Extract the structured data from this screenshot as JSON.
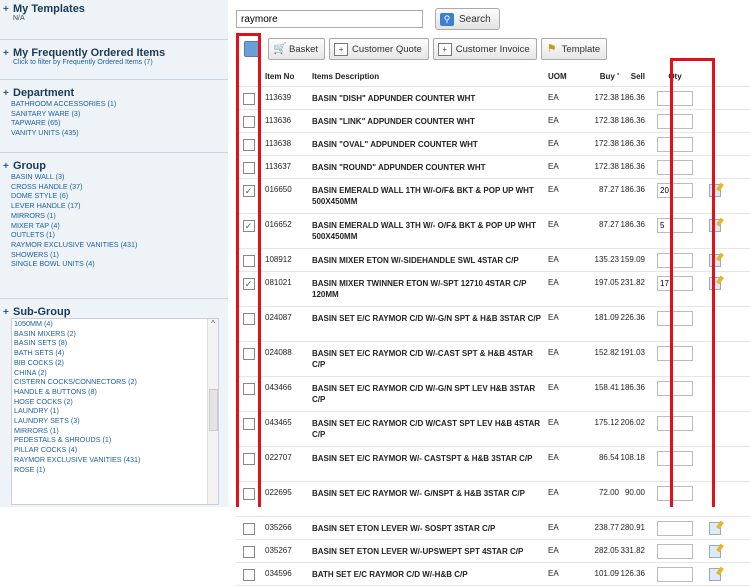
{
  "sidebar": {
    "my_templates": {
      "title": "My Templates",
      "sub": "N/A"
    },
    "frequent": {
      "title": "My Frequently Ordered Items",
      "sub": "Click to filter by Frequently Ordered Items (7)"
    },
    "department": {
      "title": "Department",
      "items": [
        "BATHROOM ACCESSORIES (1)",
        "SANITARY WARE (3)",
        "TAPWARE (65)",
        "VANITY UNITS (435)"
      ]
    },
    "group": {
      "title": "Group",
      "items": [
        "BASIN WALL (3)",
        "CROSS HANDLE (37)",
        "DOME STYLE (6)",
        "LEVER HANDLE (17)",
        "MIRRORS (1)",
        "MIXER TAP (4)",
        "OUTLETS (1)",
        "RAYMOR EXCLUSIVE VANITIES (431)",
        "SHOWERS (1)",
        "SINGLE BOWL UNITS (4)"
      ]
    },
    "subgroup": {
      "title": "Sub-Group",
      "items": [
        "1050MM (4)",
        "BASIN MIXERS (2)",
        "BASIN SETS (8)",
        "BATH SETS (4)",
        "BIB COCKS (2)",
        "CHINA (2)",
        "CISTERN COCKS/CONNECTORS (2)",
        "HANDLE & BUTTONS (8)",
        "HOSE COCKS (2)",
        "LAUNDRY (1)",
        "LAUNDRY SETS (3)",
        "MIRRORS (1)",
        "PEDESTALS & SHROUDS (1)",
        "PILLAR COCKS (4)",
        "RAYMOR EXCLUSIVE VANITIES (431)",
        "ROSE (1)"
      ]
    }
  },
  "search": {
    "value": "raymore",
    "button": "Search"
  },
  "toolbar": {
    "basket": "Basket",
    "customer_quote": "Customer Quote",
    "customer_invoice": "Customer Invoice",
    "template": "Template"
  },
  "columns": {
    "item_no": "Item No",
    "desc": "Items Description",
    "uom": "UOM",
    "buy": "Buy '",
    "sell": "Sell",
    "qty": "Qty"
  },
  "rows": [
    {
      "checked": false,
      "item": "113639",
      "desc": "BASIN \"DISH\" ADPUNDER COUNTER WHT",
      "uom": "EA",
      "buy": "172.38",
      "sell": "186.36",
      "qty": "",
      "edit": false
    },
    {
      "checked": false,
      "item": "113636",
      "desc": "BASIN \"LINK\" ADPUNDER COUNTER WHT",
      "uom": "EA",
      "buy": "172.38",
      "sell": "186.36",
      "qty": "",
      "edit": false
    },
    {
      "checked": false,
      "item": "113638",
      "desc": "BASIN \"OVAL\" ADPUNDER COUNTER WHT",
      "uom": "EA",
      "buy": "172.38",
      "sell": "186.36",
      "qty": "",
      "edit": false
    },
    {
      "checked": false,
      "item": "113637",
      "desc": "BASIN \"ROUND\" ADPUNDER COUNTER WHT",
      "uom": "EA",
      "buy": "172.38",
      "sell": "186.36",
      "qty": "",
      "edit": false
    },
    {
      "checked": true,
      "item": "016650",
      "desc": "BASIN EMERALD WALL 1TH W/-O/F& BKT & POP UP WHT 500X450MM",
      "uom": "EA",
      "buy": "87.27",
      "sell": "186.36",
      "qty": "20",
      "edit": true
    },
    {
      "checked": true,
      "item": "016652",
      "desc": "BASIN EMERALD WALL 3TH W/- O/F& BKT & POP UP WHT 500X450MM",
      "uom": "EA",
      "buy": "87.27",
      "sell": "186.36",
      "qty": "5",
      "edit": true
    },
    {
      "checked": false,
      "item": "108912",
      "desc": "BASIN MIXER ETON W/-SIDEHANDLE SWL 4STAR C/P",
      "uom": "EA",
      "buy": "135.23",
      "sell": "159.09",
      "qty": "",
      "edit": true
    },
    {
      "checked": true,
      "item": "081021",
      "desc": "BASIN MIXER TWINNER ETON W/-SPT 12710 4STAR C/P 120MM",
      "uom": "EA",
      "buy": "197.05",
      "sell": "231.82",
      "qty": "17",
      "edit": true
    },
    {
      "checked": false,
      "item": "024087",
      "desc": "BASIN SET E/C RAYMOR C/D W/-G/N SPT & H&B 3STAR C/P",
      "uom": "EA",
      "buy": "181.09",
      "sell": "226.36",
      "qty": "",
      "edit": false
    },
    {
      "checked": false,
      "item": "024088",
      "desc": "BASIN SET E/C RAYMOR C/D W/-CAST SPT & H&B 4STAR C/P",
      "uom": "EA",
      "buy": "152.82",
      "sell": "191.03",
      "qty": "",
      "edit": false
    },
    {
      "checked": false,
      "item": "043466",
      "desc": "BASIN SET E/C RAYMOR C/D W/-G/N SPT LEV H&B 3STAR C/P",
      "uom": "EA",
      "buy": "158.41",
      "sell": "186.36",
      "qty": "",
      "edit": false
    },
    {
      "checked": false,
      "item": "043465",
      "desc": "BASIN SET E/C RAYMOR C/D W/CAST SPT LEV H&B 4STAR C/P",
      "uom": "EA",
      "buy": "175.12",
      "sell": "206.02",
      "qty": "",
      "edit": false
    },
    {
      "checked": false,
      "item": "022707",
      "desc": "BASIN SET E/C RAYMOR W/- CASTSPT & H&B 3STAR C/P",
      "uom": "EA",
      "buy": "86.54",
      "sell": "108.18",
      "qty": "",
      "edit": false
    },
    {
      "checked": false,
      "item": "022695",
      "desc": "BASIN SET E/C RAYMOR W/- G/NSPT & H&B 3STAR C/P",
      "uom": "EA",
      "buy": "72.00",
      "sell": "90.00",
      "qty": "",
      "edit": false
    },
    {
      "checked": false,
      "item": "035266",
      "desc": "BASIN SET ETON LEVER W/- SOSPT 3STAR C/P",
      "uom": "EA",
      "buy": "238.77",
      "sell": "280.91",
      "qty": "",
      "edit": true
    },
    {
      "checked": false,
      "item": "035267",
      "desc": "BASIN SET ETON LEVER W/-UPSWEPT SPT 4STAR C/P",
      "uom": "EA",
      "buy": "282.05",
      "sell": "331.82",
      "qty": "",
      "edit": true
    },
    {
      "checked": false,
      "item": "034596",
      "desc": "BATH SET E/C RAYMOR C/D W/-H&B C/P",
      "uom": "EA",
      "buy": "101.09",
      "sell": "126.36",
      "qty": "",
      "edit": true
    }
  ],
  "colors": {
    "highlight": "#e3101c",
    "header_bg": "#eef3f8",
    "link": "#1f5fa3"
  }
}
